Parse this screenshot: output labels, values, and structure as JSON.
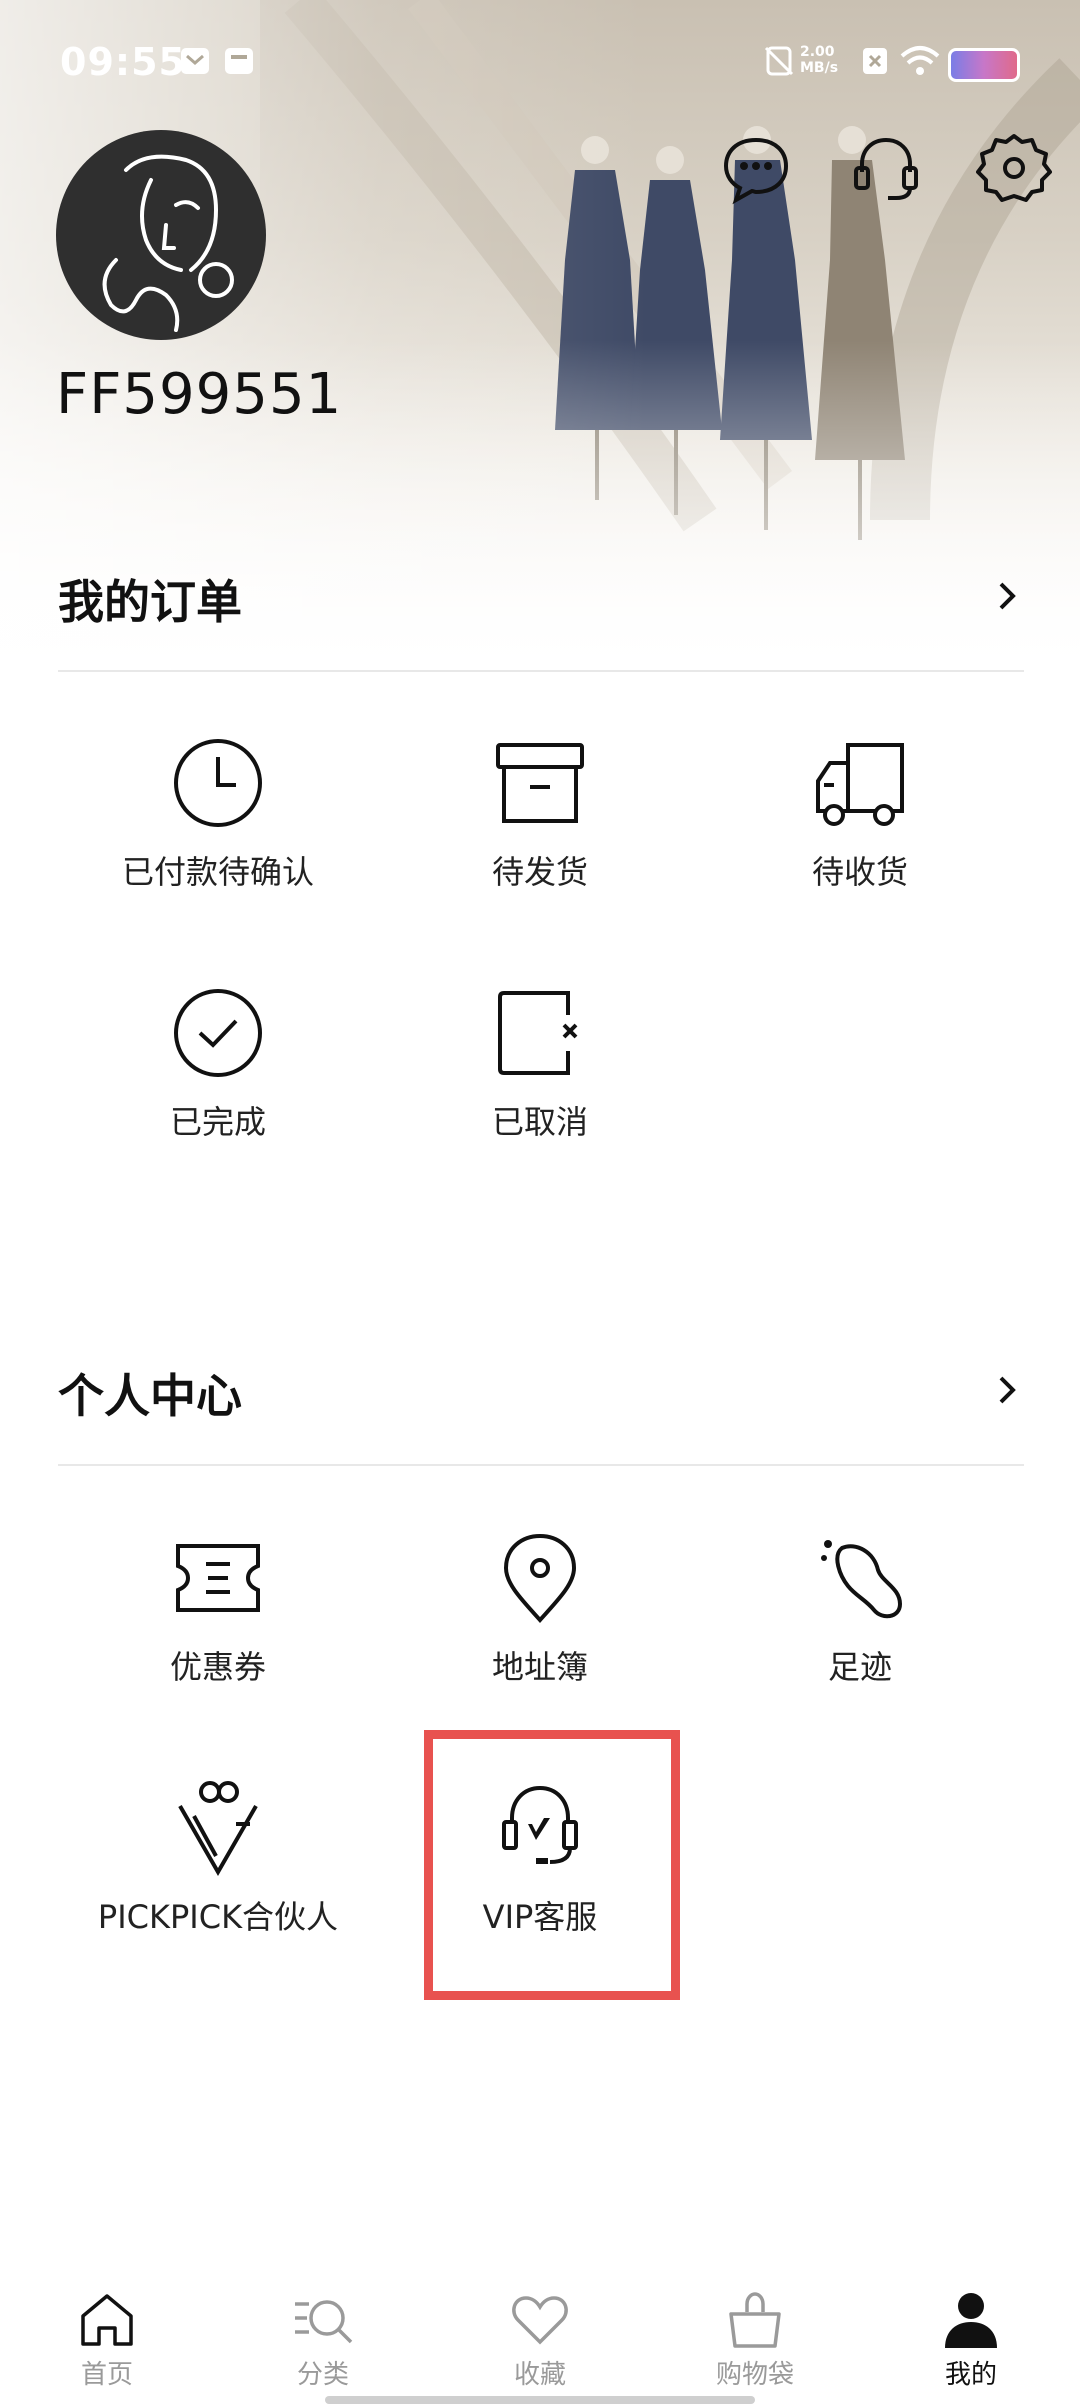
{
  "status_bar": {
    "time": "09:55",
    "icons": [
      "message-badge-icon",
      "calendar-badge-icon",
      "nfc-icon",
      "network-speed-icon",
      "sim-off-icon",
      "wifi-icon",
      "battery-icon"
    ],
    "network_speed": "2.00 MB/s"
  },
  "header": {
    "username": "FF599551",
    "actions": [
      "message-icon",
      "customer-service-icon",
      "settings-icon"
    ]
  },
  "orders": {
    "title": "我的订单",
    "items": [
      {
        "label": "已付款待确认",
        "icon": "clock-icon"
      },
      {
        "label": "待发货",
        "icon": "package-icon"
      },
      {
        "label": "待收货",
        "icon": "delivery-truck-icon"
      },
      {
        "label": "已完成",
        "icon": "check-circle-icon"
      },
      {
        "label": "已取消",
        "icon": "cancelled-icon"
      }
    ]
  },
  "personal": {
    "title": "个人中心",
    "items": [
      {
        "label": "优惠券",
        "icon": "coupon-icon"
      },
      {
        "label": "地址簿",
        "icon": "location-pin-icon"
      },
      {
        "label": "足迹",
        "icon": "footprint-icon"
      },
      {
        "label": "PICKPICK合伙人",
        "icon": "partner-icon"
      },
      {
        "label": "VIP客服",
        "icon": "vip-headset-icon"
      }
    ]
  },
  "bottom_nav": {
    "items": [
      {
        "label": "首页",
        "icon": "home-icon"
      },
      {
        "label": "分类",
        "icon": "category-search-icon"
      },
      {
        "label": "收藏",
        "icon": "heart-icon"
      },
      {
        "label": "购物袋",
        "icon": "shopping-bag-icon"
      },
      {
        "label": "我的",
        "icon": "profile-icon"
      }
    ],
    "active": "我的"
  },
  "colors": {
    "highlight": "#e8524f",
    "text": "#111111",
    "inactive_nav": "#9a9a9a"
  }
}
